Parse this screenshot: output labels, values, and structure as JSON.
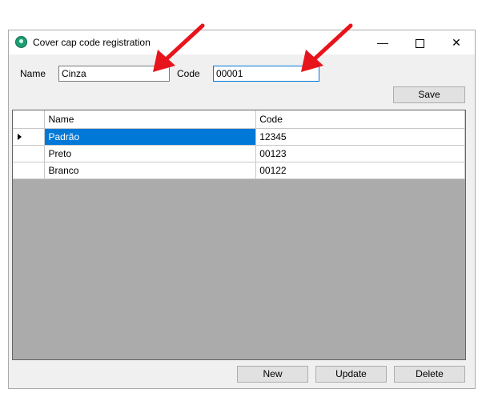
{
  "window": {
    "title": "Cover cap code registration",
    "controls": {
      "minimize": "—",
      "close": "✕"
    }
  },
  "form": {
    "name_label": "Name",
    "name_value": "Cinza",
    "code_label": "Code",
    "code_value": "00001",
    "save_label": "Save"
  },
  "grid": {
    "columns": [
      "Name",
      "Code"
    ],
    "rows": [
      {
        "name": "Padrão",
        "code": "12345",
        "selected": true
      },
      {
        "name": "Preto",
        "code": "00123",
        "selected": false
      },
      {
        "name": "Branco",
        "code": "00122",
        "selected": false
      }
    ]
  },
  "buttons": {
    "new_label": "New",
    "update_label": "Update",
    "delete_label": "Delete"
  },
  "colors": {
    "selection": "#0078d7",
    "annotation_arrow": "#e8141b",
    "grid_background": "#ababab"
  },
  "icons": [
    "app-icon",
    "annotation-arrow",
    "row-indicator-icon"
  ]
}
